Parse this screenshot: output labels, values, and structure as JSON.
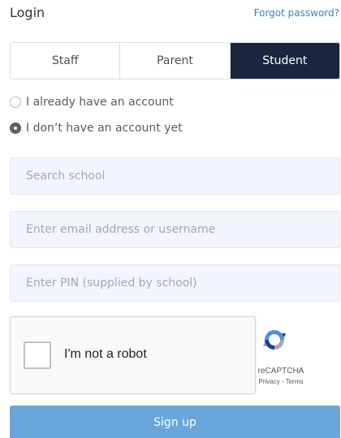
{
  "header": {
    "title": "Login",
    "forgot_label": "Forgot password?"
  },
  "tabs": [
    {
      "label": "Staff",
      "active": false
    },
    {
      "label": "Parent",
      "active": false
    },
    {
      "label": "Student",
      "active": true
    }
  ],
  "account_options": [
    {
      "label": "I already have an account",
      "checked": false
    },
    {
      "label": "I don’t have an account yet",
      "checked": true
    }
  ],
  "fields": {
    "school": {
      "placeholder": "Search school",
      "value": ""
    },
    "email": {
      "placeholder": "Enter email address or username",
      "value": ""
    },
    "pin": {
      "placeholder": "Enter PIN (supplied by school)",
      "value": ""
    }
  },
  "captcha": {
    "label": "I'm not a robot",
    "brand": "reCAPTCHA",
    "links": "Privacy - Terms",
    "checked": false
  },
  "signup_label": "Sign up",
  "colors": {
    "active_tab": "#1a2640",
    "link": "#3b82c4",
    "signup_button": "#6aa6dc",
    "field_bg": "#f3f5fd"
  }
}
